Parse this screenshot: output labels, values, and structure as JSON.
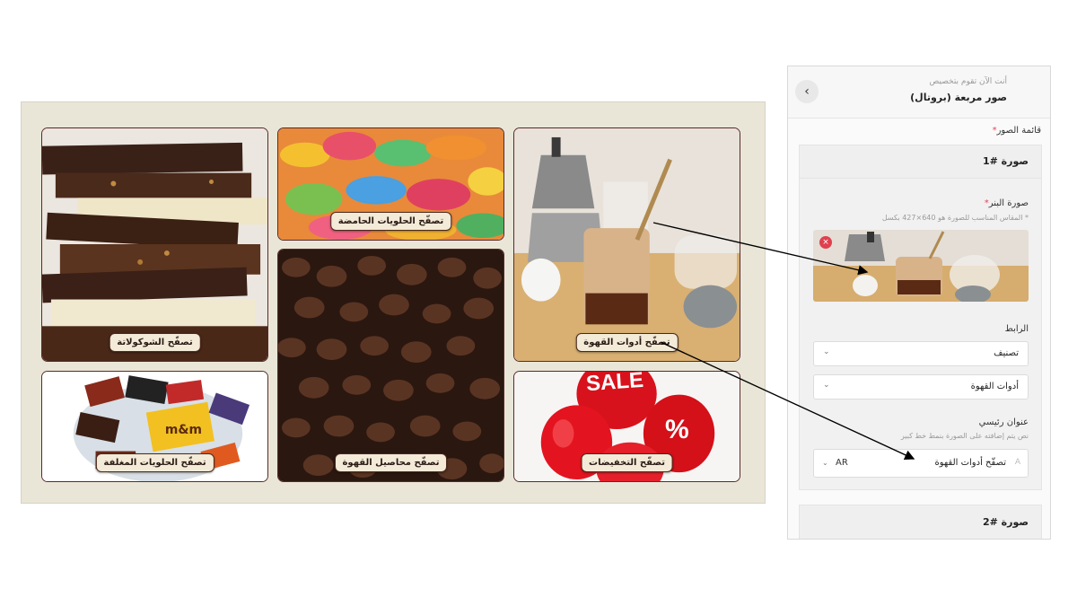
{
  "grid": {
    "tiles": [
      {
        "label": "تصفّح الشوكولاتة"
      },
      {
        "label": "تصفّح الحلويات الحامضة"
      },
      {
        "label": "تصفّح محاصيل القهوة"
      },
      {
        "label": "تصفّح أدوات القهوة"
      },
      {
        "label": "تصفّح الحلويات المغلفة"
      },
      {
        "label": "تصفّح التخفيضات"
      }
    ],
    "sale_text": "SALE",
    "percent_text": "%"
  },
  "panel": {
    "back_icon": "chevron-left-icon",
    "subtitle": "أنت الآن تقوم بتخصيص",
    "title": "صور مربعة (بروتال)",
    "images_list_label": "قائمة الصور",
    "required_mark": "*",
    "card1": {
      "title": "صورة #1",
      "banner_label": "صورة البنر",
      "banner_hint": "* المقاس المناسب للصورة هو 640×427 بكسل",
      "remove_icon": "×",
      "link_label": "الرابط",
      "link_type_value": "تصنيف",
      "link_target_value": "أدوات القهوة",
      "heading_label": "عنوان رئيسي",
      "heading_hint": "نص يتم إضافته على الصورة بنمط خط كبير",
      "heading_value": "تصفّح أدوات القهوة",
      "language": "AR"
    },
    "card2": {
      "title": "صورة #2"
    }
  },
  "colors": {
    "frame_bg": "#e9e6d8",
    "tile_border": "#5a2a2a",
    "label_bg": "#f3ead8",
    "remove_red": "#e0404e",
    "required_red": "#e0485a"
  }
}
